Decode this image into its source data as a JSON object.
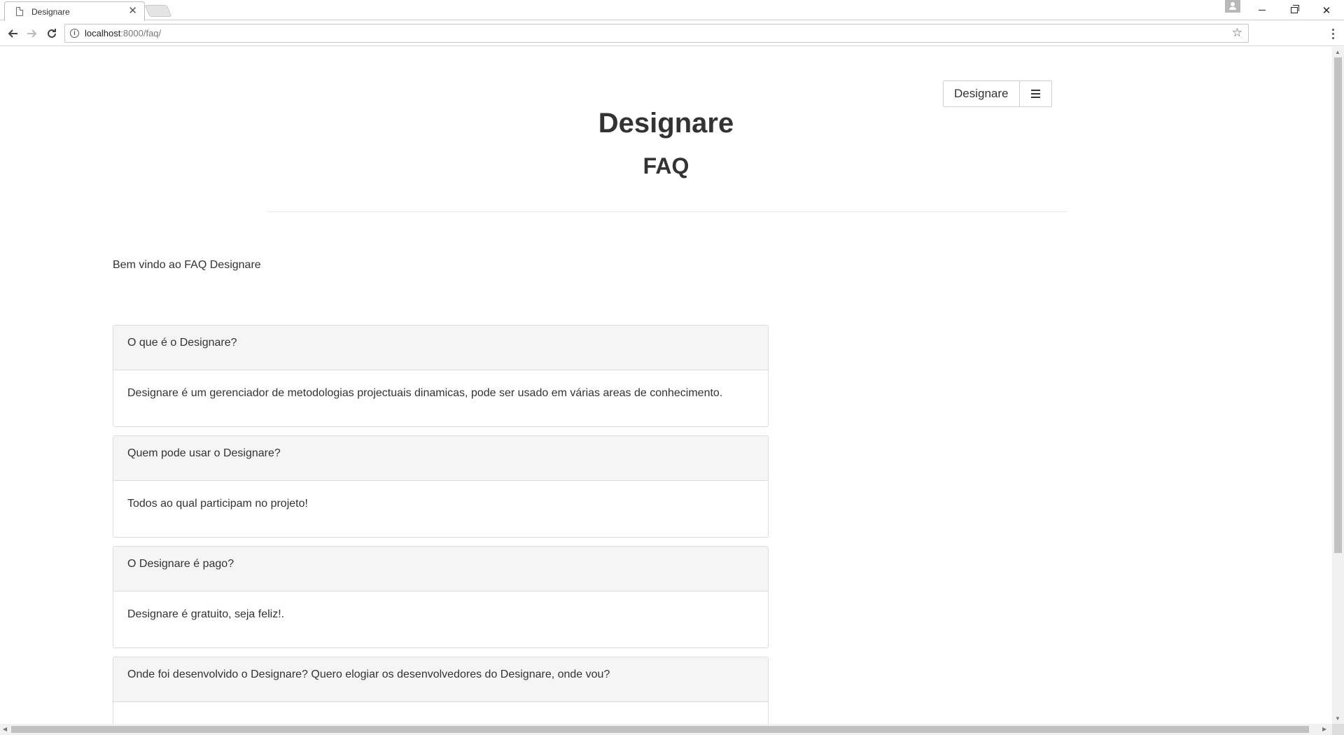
{
  "browser": {
    "tab_title": "Designare",
    "tab_close": "✕",
    "url_host": "localhost",
    "url_rest": ":8000/faq/",
    "icons": {
      "back": "arrow-left-icon",
      "forward": "arrow-right-icon",
      "reload": "reload-icon",
      "info": "info-icon",
      "star": "star-icon",
      "menu": "kebab-menu-icon"
    }
  },
  "window_controls": {
    "close": "✕"
  },
  "header": {
    "brand_button": "Designare",
    "site_title": "Designare",
    "page_subtitle": "FAQ"
  },
  "intro": "Bem vindo ao FAQ Designare",
  "faq": [
    {
      "question": "O que é o Designare?",
      "answer": "Designare é um gerenciador de metodologias projectuais dinamicas, pode ser usado em várias areas de conhecimento."
    },
    {
      "question": "Quem pode usar o Designare?",
      "answer": "Todos ao qual participam no projeto!"
    },
    {
      "question": "O Designare é pago?",
      "answer": "Designare é gratuito, seja feliz!."
    },
    {
      "question": "Onde foi desenvolvido o Designare? Quero elogiar os desenvolvedores do Designare, onde vou?",
      "answer": ""
    }
  ],
  "colors": {
    "card_header_bg": "#f5f5f5",
    "border": "#dcdcdc",
    "text": "#333333"
  }
}
